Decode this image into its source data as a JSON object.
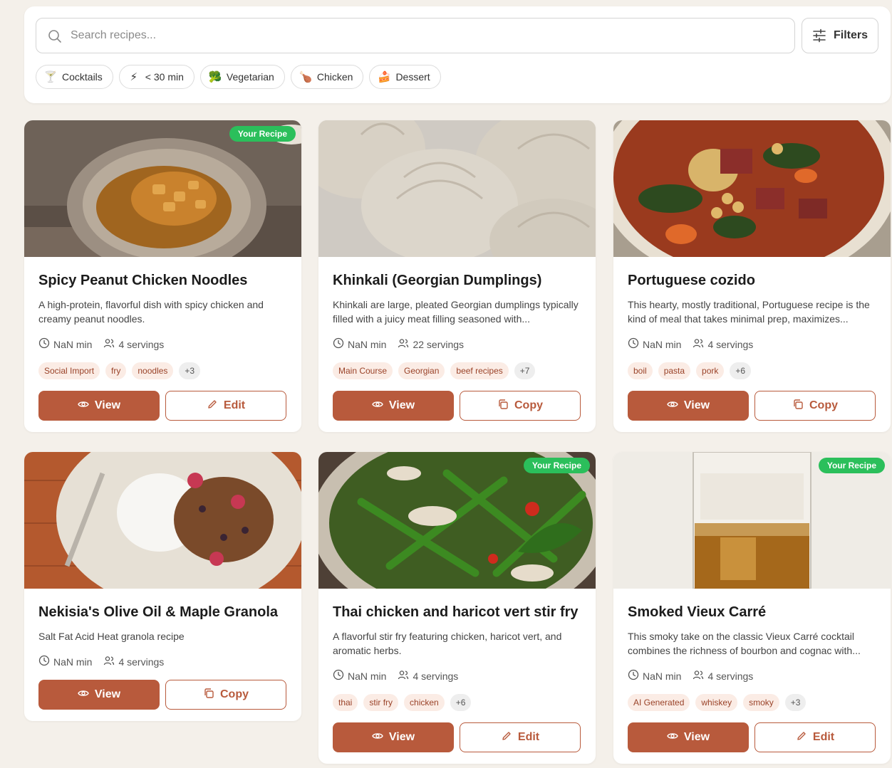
{
  "search": {
    "placeholder": "Search recipes...",
    "filters_label": "Filters"
  },
  "quick_filters": [
    {
      "emoji": "🍸",
      "label": "Cocktails"
    },
    {
      "emoji": "⚡",
      "label": "< 30 min"
    },
    {
      "emoji": "🥦",
      "label": "Vegetarian"
    },
    {
      "emoji": "🍗",
      "label": "Chicken"
    },
    {
      "emoji": "🍰",
      "label": "Dessert"
    }
  ],
  "labels": {
    "view": "View",
    "edit": "Edit",
    "copy": "Copy",
    "your_recipe": "Your Recipe"
  },
  "colors": {
    "accent": "#b85a3c",
    "badge": "#2bbf5b",
    "tag_bg": "#fbece5",
    "background": "#f4f0ea"
  },
  "recipes": [
    {
      "title": "Spicy Peanut Chicken Noodles",
      "description": "A high-protein, flavorful dish with spicy chicken and creamy peanut noodles.",
      "time": "NaN min",
      "servings": "4 servings",
      "tags": [
        "Social Import",
        "fry",
        "noodles"
      ],
      "more_tags": "+3",
      "badge": "Your Recipe",
      "secondary_action": "Edit"
    },
    {
      "title": "Khinkali (Georgian Dumplings)",
      "description": "Khinkali are large, pleated Georgian dumplings typically filled with a juicy meat filling seasoned with...",
      "time": "NaN min",
      "servings": "22 servings",
      "tags": [
        "Main Course",
        "Georgian",
        "beef recipes"
      ],
      "more_tags": "+7",
      "badge": "",
      "secondary_action": "Copy"
    },
    {
      "title": "Portuguese cozido",
      "description": "This hearty, mostly traditional, Portuguese recipe is the kind of meal that takes minimal prep, maximizes...",
      "time": "NaN min",
      "servings": "4 servings",
      "tags": [
        "boil",
        "pasta",
        "pork"
      ],
      "more_tags": "+6",
      "badge": "",
      "secondary_action": "Copy"
    },
    {
      "title": "Nekisia's Olive Oil & Maple Granola",
      "description": "Salt Fat Acid Heat granola recipe",
      "time": "NaN min",
      "servings": "4 servings",
      "tags": [],
      "more_tags": "",
      "badge": "",
      "secondary_action": "Copy"
    },
    {
      "title": "Thai chicken and haricot vert stir fry",
      "description": "A flavorful stir fry featuring chicken, haricot vert, and aromatic herbs.",
      "time": "NaN min",
      "servings": "4 servings",
      "tags": [
        "thai",
        "stir fry",
        "chicken"
      ],
      "more_tags": "+6",
      "badge": "Your Recipe",
      "secondary_action": "Edit"
    },
    {
      "title": "Smoked Vieux Carré",
      "description": "This smoky take on the classic Vieux Carré cocktail combines the richness of bourbon and cognac with...",
      "time": "NaN min",
      "servings": "4 servings",
      "tags": [
        "AI Generated",
        "whiskey",
        "smoky"
      ],
      "more_tags": "+3",
      "badge": "Your Recipe",
      "secondary_action": "Edit"
    }
  ]
}
